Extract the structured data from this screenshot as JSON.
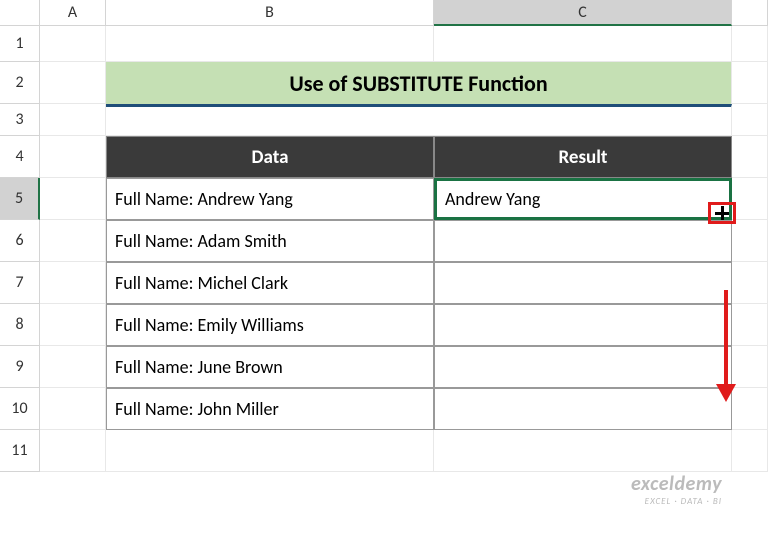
{
  "columns": [
    "A",
    "B",
    "C"
  ],
  "rows": [
    "1",
    "2",
    "3",
    "4",
    "5",
    "6",
    "7",
    "8",
    "9",
    "10",
    "11"
  ],
  "title": "Use of SUBSTITUTE Function",
  "headers": {
    "data": "Data",
    "result": "Result"
  },
  "dataRows": [
    "Full Name: Andrew Yang",
    "Full Name: Adam Smith",
    "Full Name: Michel Clark",
    "Full Name: Emily Williams",
    "Full Name: June Brown",
    "Full Name: John Miller"
  ],
  "resultRows": [
    "Andrew Yang",
    "",
    "",
    "",
    "",
    ""
  ],
  "watermark": {
    "main": "exceldemy",
    "sub": "EXCEL · DATA · BI"
  }
}
